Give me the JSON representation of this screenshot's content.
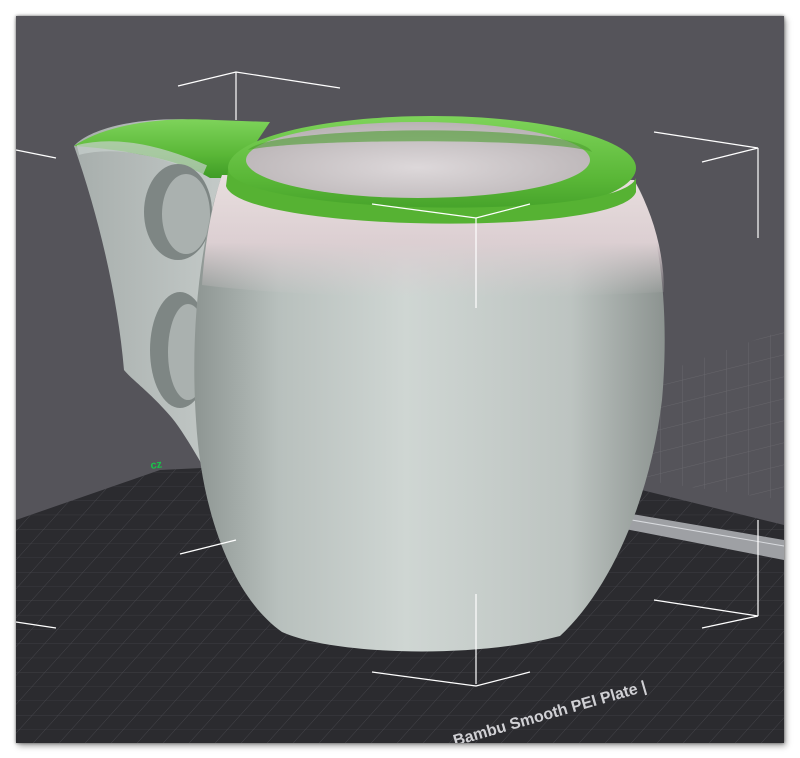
{
  "viewport": {
    "background_color": "#55545a",
    "bed_surface_color": "#2b2b2f",
    "bed_grid_color": "#4a4a50",
    "bed_label": "Bambu Smooth PEI Plate",
    "bed_label_suffix": "| "
  },
  "model": {
    "name": "pitcher",
    "body_color": "#c6cbc8",
    "upper_band_color": "#d8ccd0",
    "rim_color": "#5cbd39",
    "selected": true
  },
  "selection_box": {
    "color": "#ffffff"
  },
  "colors": {
    "axis_indicator": "#18c44a"
  }
}
